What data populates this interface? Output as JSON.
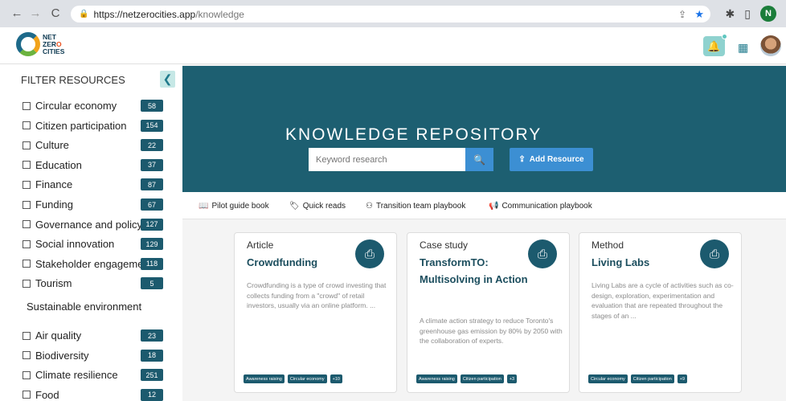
{
  "browser": {
    "url_host": "https://netzerocities.app",
    "url_path": "/knowledge",
    "profile_initial": "N"
  },
  "logo": {
    "line1": "NET",
    "line2a": "ZER",
    "line2b": "O",
    "line3": "CITIES"
  },
  "sidebar": {
    "title": "FILTER RESOURCES",
    "items": [
      {
        "label": "Circular economy",
        "count": "58"
      },
      {
        "label": "Citizen participation",
        "count": "154"
      },
      {
        "label": "Culture",
        "count": "22"
      },
      {
        "label": "Education",
        "count": "37"
      },
      {
        "label": "Finance",
        "count": "87"
      },
      {
        "label": "Funding",
        "count": "67"
      },
      {
        "label": "Governance and policy",
        "count": "127"
      },
      {
        "label": "Social innovation",
        "count": "129"
      },
      {
        "label": "Stakeholder engagement",
        "count": "118"
      },
      {
        "label": "Tourism",
        "count": "5"
      }
    ],
    "group_label": "Sustainable environment",
    "group_items": [
      {
        "label": "Air quality",
        "count": "23"
      },
      {
        "label": "Biodiversity",
        "count": "18"
      },
      {
        "label": "Climate resilience",
        "count": "251"
      },
      {
        "label": "Food",
        "count": "12"
      }
    ]
  },
  "hero": {
    "title": "KNOWLEDGE REPOSITORY",
    "search_placeholder": "Keyword research",
    "add_label": "Add Resource"
  },
  "tabs": [
    {
      "label": "Pilot guide book"
    },
    {
      "label": "Quick reads"
    },
    {
      "label": "Transition team playbook"
    },
    {
      "label": "Communication playbook"
    }
  ],
  "cards": [
    {
      "type": "Article",
      "title": "Crowdfunding",
      "desc": "Crowdfunding is a type of crowd investing that collects funding from a \"crowd\" of retail investors, usually via an online platform. ...",
      "tags": [
        "Awareness raising",
        "Circular economy",
        "+10"
      ]
    },
    {
      "type": "Case study",
      "title": "TransformTO: Multisolving in Action",
      "desc": "A climate action strategy to reduce Toronto's greenhouse gas emission by 80% by 2050 with the collaboration of experts.",
      "tags": [
        "Awareness raising",
        "Citizen participation",
        "+3"
      ]
    },
    {
      "type": "Method",
      "title": "Living Labs",
      "desc": "Living Labs are a cycle of activities such as co-design, exploration, experimentation and evaluation that are repeated throughout the stages of an ...",
      "tags": [
        "Circular economy",
        "Citizen participation",
        "+9"
      ]
    }
  ],
  "colors": {
    "primary": "#1c5a6e",
    "hero": "#1d5f71",
    "accent_blue": "#3c8fd3"
  }
}
